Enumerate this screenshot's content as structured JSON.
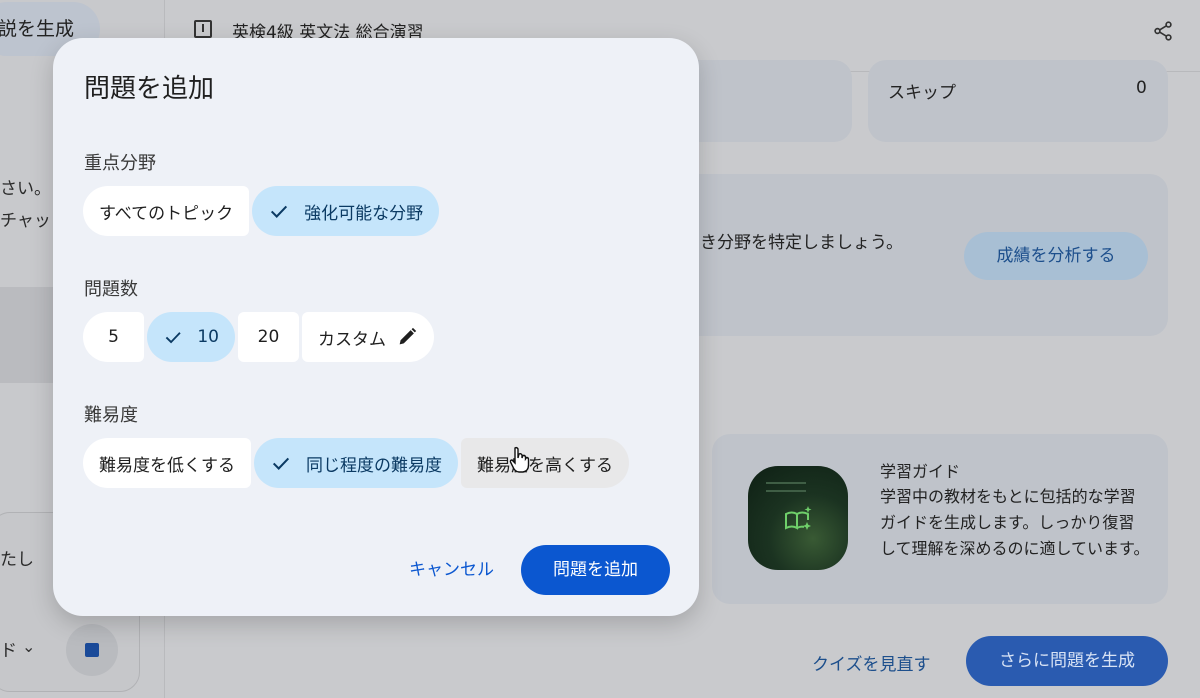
{
  "background": {
    "left_panel": {
      "generate_button_label": "説を生成",
      "text_line1": "さい。",
      "text_line2": "チャッ",
      "text_line3": "たし",
      "dropdown_fragment": "ド"
    },
    "topbar": {
      "title": "英検4級 英文法 総合演習"
    },
    "stats": {
      "skip_label": "スキップ",
      "skip_value": "0"
    },
    "analysis": {
      "text": "き分野を特定しましょう。",
      "button_label": "成績を分析する"
    },
    "study_guide": {
      "title": "学習ガイド",
      "description": "学習中の教材をもとに包括的な学習ガイドを生成します。しっかり復習して理解を深めるのに適しています。"
    },
    "footer": {
      "review_link": "クイズを見直す",
      "more_button": "さらに問題を生成"
    }
  },
  "dialog": {
    "title": "問題を追加",
    "focus": {
      "label": "重点分野",
      "options": [
        "すべてのトピック",
        "強化可能な分野"
      ],
      "selected": "強化可能な分野"
    },
    "count": {
      "label": "問題数",
      "options": [
        "5",
        "10",
        "20",
        "カスタム"
      ],
      "selected": "10"
    },
    "difficulty": {
      "label": "難易度",
      "options": [
        "難易度を低くする",
        "同じ程度の難易度",
        "難易度を高くする"
      ],
      "selected": "同じ程度の難易度"
    },
    "cancel_label": "キャンセル",
    "submit_label": "問題を追加"
  },
  "colors": {
    "primary": "#0b57d0",
    "chip_selected_bg": "#c5e5fb",
    "dialog_bg": "#eef1f7"
  }
}
